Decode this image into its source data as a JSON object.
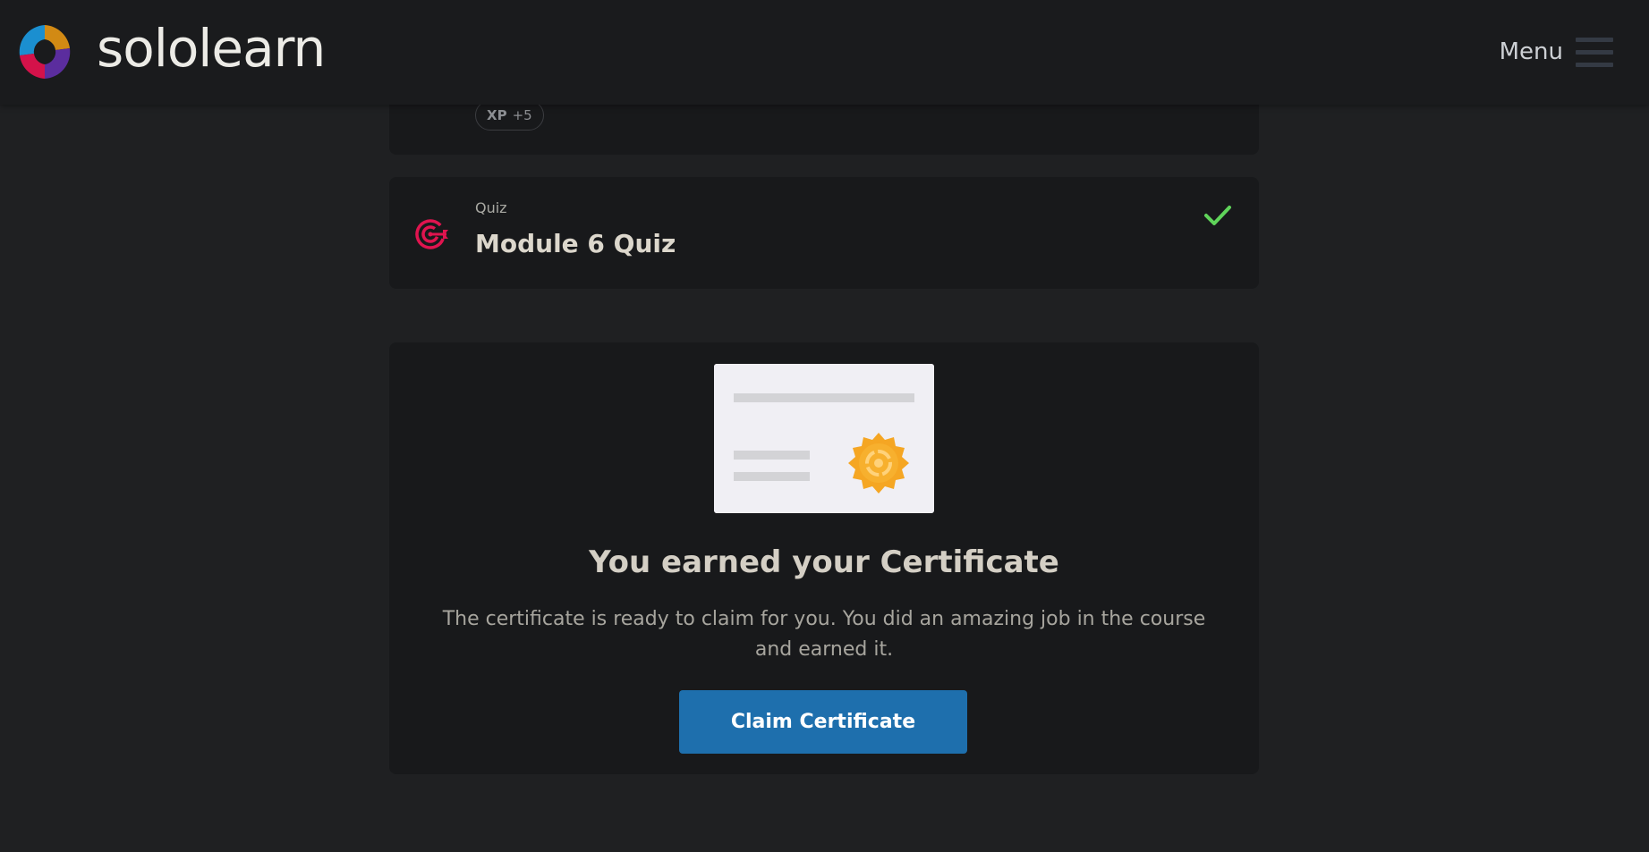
{
  "header": {
    "brand": "sololearn",
    "menu_label": "Menu",
    "logo_icon": "sololearn-logo-icon",
    "menu_icon": "hamburger-menu-icon"
  },
  "prev_card": {
    "xp_label": "XP",
    "xp_value": "+5"
  },
  "quiz_card": {
    "type_label": "Quiz",
    "title": "Module 6 Quiz",
    "icon": "target-icon",
    "status_icon": "checkmark-icon",
    "status": "completed"
  },
  "certificate_card": {
    "image_icon": "certificate-illustration",
    "title": "You earned your Certificate",
    "text": "The certificate is ready to claim for you. You did an amazing job in the course and earned it.",
    "button_label": "Claim Certificate"
  },
  "colors": {
    "background": "#1f2022",
    "card": "#18191b",
    "accent_button": "#1e6fad",
    "quiz_icon": "#e0144f",
    "check": "#5fd45a",
    "seal": "#f5a623"
  }
}
